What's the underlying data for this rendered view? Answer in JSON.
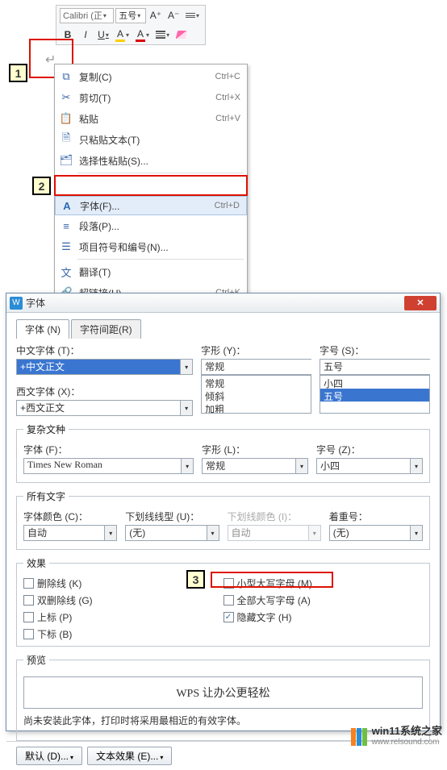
{
  "toolbar": {
    "font_name": "Calibri (正",
    "font_size": "五号",
    "bold": "B",
    "italic": "I",
    "underline": "U",
    "a_plus": "A⁺",
    "a_minus": "A⁻"
  },
  "step_labels": {
    "s1": "1",
    "s2": "2",
    "s3": "3"
  },
  "context_menu": {
    "copy": {
      "label": "复制(C)",
      "shortcut": "Ctrl+C"
    },
    "cut": {
      "label": "剪切(T)",
      "shortcut": "Ctrl+X"
    },
    "paste": {
      "label": "粘贴",
      "shortcut": "Ctrl+V"
    },
    "paste_plain": {
      "label": "只粘贴文本(T)",
      "shortcut": ""
    },
    "paste_special": {
      "label": "选择性粘贴(S)...",
      "shortcut": ""
    },
    "font": {
      "label": "字体(F)...",
      "shortcut": "Ctrl+D"
    },
    "paragraph": {
      "label": "段落(P)...",
      "shortcut": ""
    },
    "bullets": {
      "label": "项目符号和编号(N)...",
      "shortcut": ""
    },
    "translate": {
      "label": "翻译(T)",
      "shortcut": ""
    },
    "hyperlink": {
      "label": "超链接(H)...",
      "shortcut": "Ctrl+K"
    }
  },
  "dialog": {
    "title": "字体",
    "tabs": {
      "font": "字体 (N)",
      "spacing": "字符间距(R)"
    },
    "chinese_font_label": "中文字体 (T)：",
    "chinese_font_value": "+中文正文",
    "western_font_label": "西文字体 (X)：",
    "western_font_value": "+西文正文",
    "style_label": "字形 (Y)：",
    "style_value": "常规",
    "style_list": [
      "常规",
      "倾斜",
      "加粗"
    ],
    "size_label": "字号 (S)：",
    "size_value": "五号",
    "size_list": [
      "小四",
      "五号"
    ],
    "complex_legend": "复杂文种",
    "complex_font_label": "字体 (F)：",
    "complex_font_value": "Times New Roman",
    "complex_style_label": "字形 (L)：",
    "complex_style_value": "常规",
    "complex_size_label": "字号 (Z)：",
    "complex_size_value": "小四",
    "alltext_legend": "所有文字",
    "font_color_label": "字体颜色 (C)：",
    "font_color_value": "自动",
    "underline_style_label": "下划线线型 (U)：",
    "underline_style_value": "(无)",
    "underline_color_label": "下划线颜色 (I)：",
    "underline_color_value": "自动",
    "emphasis_label": "着重号：",
    "emphasis_value": "(无)",
    "effects_legend": "效果",
    "fx": {
      "strikethrough": "删除线 (K)",
      "dbl_strike": "双删除线 (G)",
      "superscript": "上标 (P)",
      "subscript": "下标 (B)",
      "smallcaps": "小型大写字母 (M)",
      "allcaps": "全部大写字母 (A)",
      "hidden": "隐藏文字 (H)"
    },
    "preview_legend": "预览",
    "preview_text": "WPS 让办公更轻松",
    "note": "尚未安装此字体，打印时将采用最相近的有效字体。",
    "btn_default": "默认 (D)...",
    "btn_texteffect": "文本效果 (E)..."
  },
  "watermark": {
    "brand": "win11系统之家",
    "url": "www.relsound.com"
  }
}
